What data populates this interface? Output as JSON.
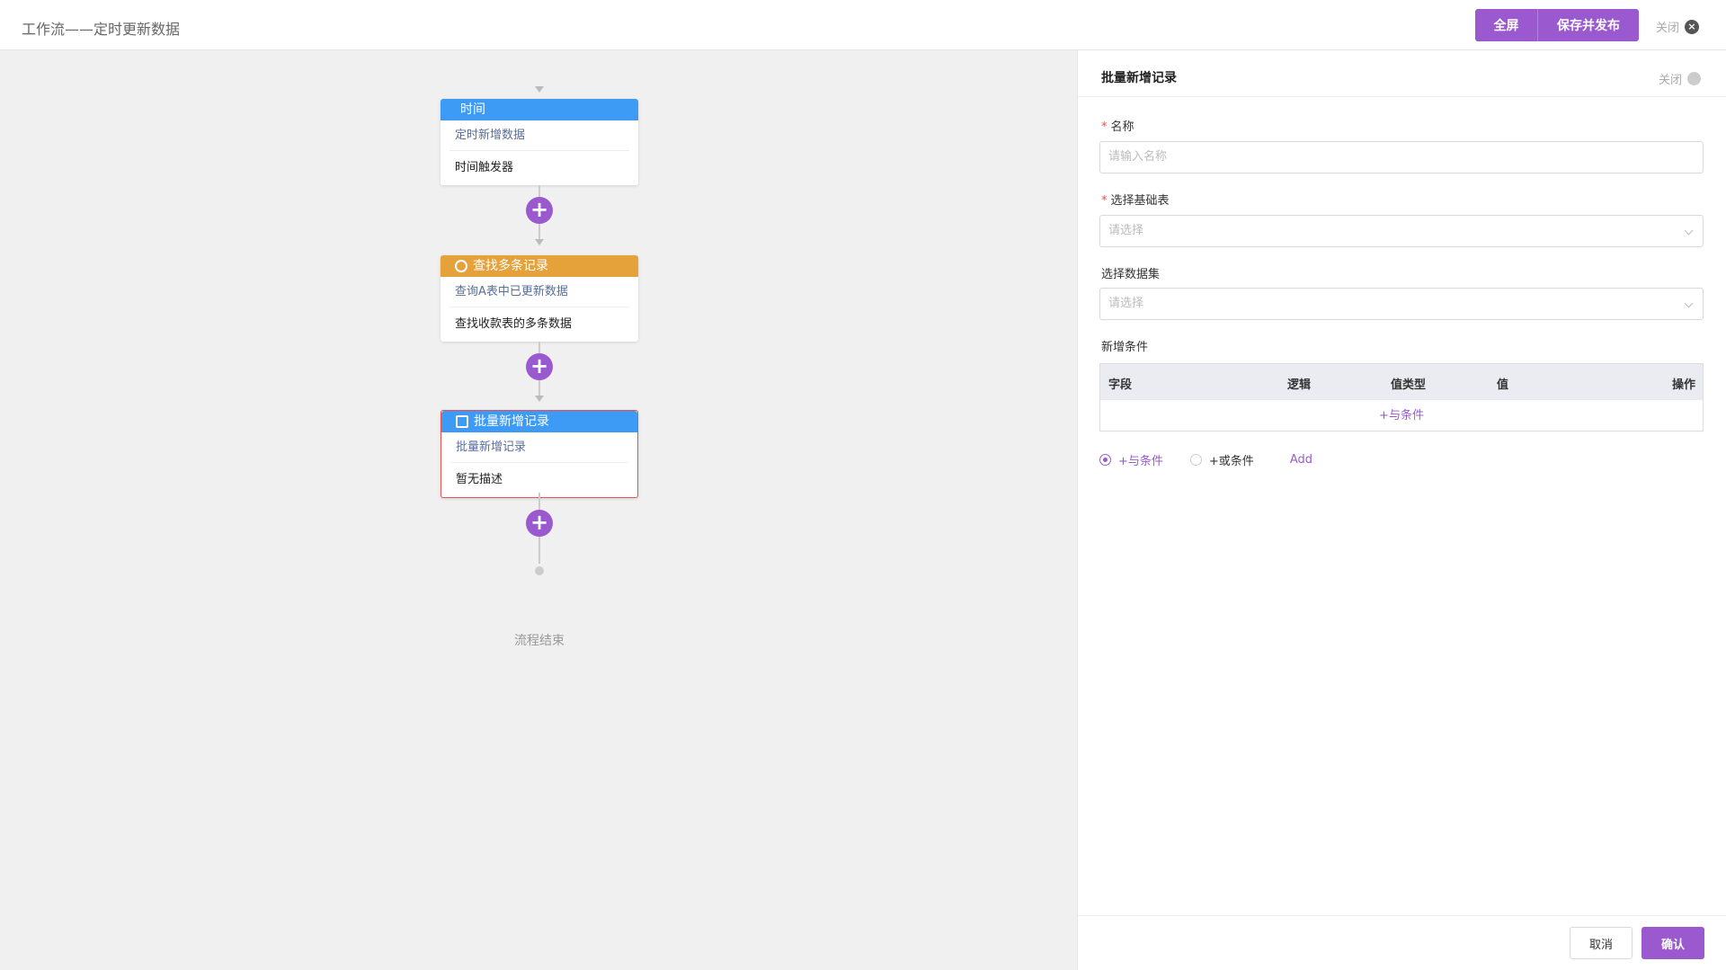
{
  "header": {
    "title": "工作流——定时更新数据",
    "fullscreen_label": "全屏",
    "save_publish_label": "保存并发布",
    "close_label": "关闭",
    "accent_color": "#9b59d0"
  },
  "flow": {
    "nodes": [
      {
        "type_label": "时间",
        "name": "定时新增数据",
        "description": "时间触发器",
        "header_color": "#3d9bf5",
        "icon": ""
      },
      {
        "type_label": "查找多条记录",
        "name": "查询A表中已更新数据",
        "description": "查找收款表的多条数据",
        "header_color": "#e5a23a",
        "icon": "search-icon"
      },
      {
        "type_label": "批量新增记录",
        "name": "批量新增记录",
        "description": "暂无描述",
        "header_color": "#3d9bf5",
        "icon": "add-record-icon",
        "selected": true
      }
    ],
    "end_label": "流程结束"
  },
  "panel": {
    "title": "批量新增记录",
    "close_label": "关闭",
    "name_label": "名称",
    "name_placeholder": "请输入名称",
    "base_table_label": "选择基础表",
    "base_table_placeholder": "请选择",
    "dataset_label": "选择数据集",
    "dataset_placeholder": "请选择",
    "conditions_label": "新增条件",
    "condition_columns": [
      "字段",
      "逻辑",
      "值类型",
      "值",
      "操作"
    ],
    "add_and_condition": "+与条件",
    "radio_and": "+与条件",
    "radio_or": "+或条件",
    "add_link": "Add",
    "cancel_label": "取消",
    "confirm_label": "确认"
  }
}
